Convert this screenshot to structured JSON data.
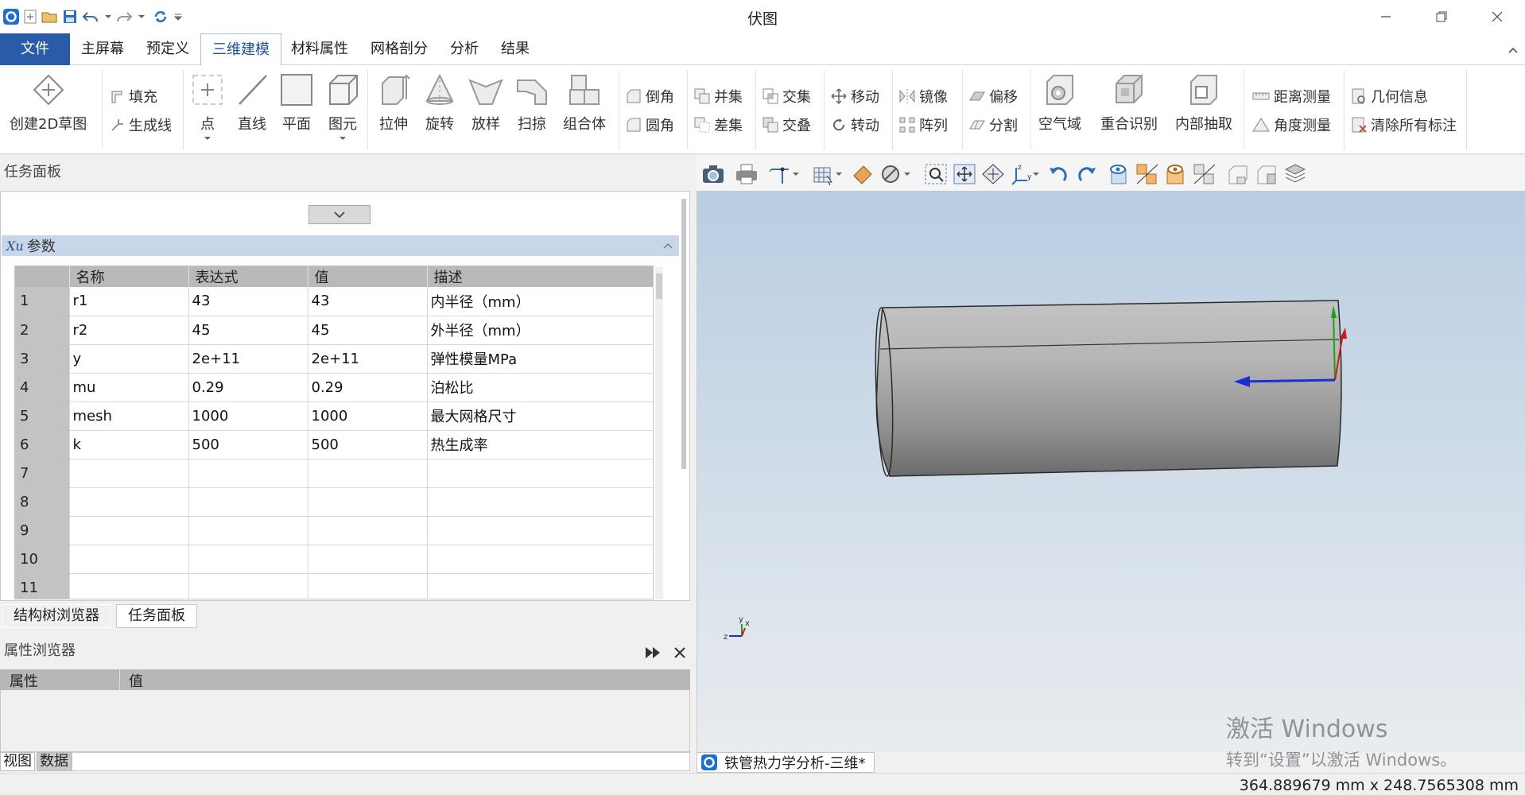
{
  "app": {
    "title": "伏图"
  },
  "menu": {
    "file": "文件",
    "tabs": [
      "主屏幕",
      "预定义",
      "三维建模",
      "材料属性",
      "网格剖分",
      "分析",
      "结果"
    ],
    "active_tab": "三维建模"
  },
  "ribbon": {
    "create_2d_sketch": "创建2D草图",
    "fill": "填充",
    "generate_line": "生成线",
    "point": "点",
    "line": "直线",
    "plane": "平面",
    "primitive": "图元",
    "extrude": "拉伸",
    "revolve": "旋转",
    "loft": "放样",
    "sweep": "扫掠",
    "compound": "组合体",
    "chamfer": "倒角",
    "fillet": "圆角",
    "union": "并集",
    "difference": "差集",
    "intersect": "交集",
    "overlap": "交叠",
    "move": "移动",
    "rotate": "转动",
    "mirror": "镜像",
    "array": "阵列",
    "offset": "偏移",
    "split": "分割",
    "air_domain": "空气域",
    "overlap_detect": "重合识别",
    "inner_extract": "内部抽取",
    "distance_measure": "距离测量",
    "angle_measure": "角度测量",
    "geometry_info": "几何信息",
    "clear_annotations": "清除所有标注"
  },
  "task_panel": {
    "title": "任务面板",
    "params_header": "参数",
    "params_prefix": "Xu",
    "columns": [
      "名称",
      "表达式",
      "值",
      "描述"
    ],
    "rows": [
      {
        "no": "1",
        "name": "r1",
        "expr": "43",
        "value": "43",
        "desc": "内半径（mm）"
      },
      {
        "no": "2",
        "name": "r2",
        "expr": "45",
        "value": "45",
        "desc": "外半径（mm）"
      },
      {
        "no": "3",
        "name": "y",
        "expr": "2e+11",
        "value": "2e+11",
        "desc": "弹性模量MPa"
      },
      {
        "no": "4",
        "name": "mu",
        "expr": "0.29",
        "value": "0.29",
        "desc": "泊松比"
      },
      {
        "no": "5",
        "name": "mesh",
        "expr": "1000",
        "value": "1000",
        "desc": "最大网格尺寸"
      },
      {
        "no": "6",
        "name": "k",
        "expr": "500",
        "value": "500",
        "desc": "热生成率"
      },
      {
        "no": "7",
        "name": "",
        "expr": "",
        "value": "",
        "desc": ""
      },
      {
        "no": "8",
        "name": "",
        "expr": "",
        "value": "",
        "desc": ""
      },
      {
        "no": "9",
        "name": "",
        "expr": "",
        "value": "",
        "desc": ""
      },
      {
        "no": "10",
        "name": "",
        "expr": "",
        "value": "",
        "desc": ""
      },
      {
        "no": "11",
        "name": "",
        "expr": "",
        "value": "",
        "desc": ""
      }
    ]
  },
  "bottom_tabs": [
    "结构树浏览器",
    "任务面板"
  ],
  "property_browser": {
    "title": "属性浏览器",
    "col_property": "属性",
    "col_value": "值",
    "view_tabs": [
      "视图",
      "数据"
    ]
  },
  "viewport": {
    "doc_tab": "铁管热力学分析-三维*",
    "axis_labels": {
      "x": "x",
      "y": "y",
      "z": "z"
    }
  },
  "watermark": {
    "line1": "激活 Windows",
    "line2": "转到“设置”以激活 Windows。"
  },
  "status": {
    "dimensions": "364.889679 mm x 248.7565308 mm"
  },
  "colors": {
    "accent": "#2a5ba8",
    "param_header": "#c7d7e9",
    "viewport_top": "#b9cde2"
  }
}
